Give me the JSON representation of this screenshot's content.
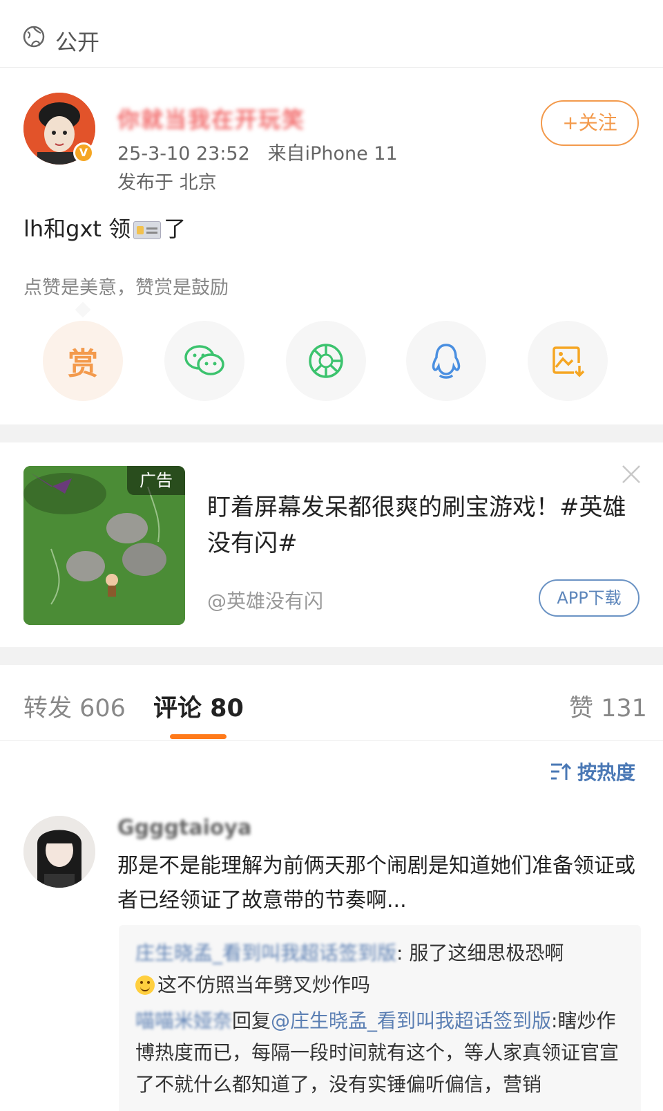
{
  "header": {
    "visibility_label": "公开"
  },
  "post": {
    "author_name": "你就当我在开玩笑",
    "timestamp": "25-3-10 23:52",
    "source": "来自iPhone 11",
    "location": "发布于 北京",
    "follow_label": "+关注",
    "text_before": "lh和gxt 领",
    "text_after": "了",
    "reward_hint": "点赞是美意，赞赏是鼓励",
    "reward_label": "赏"
  },
  "share_icons": [
    "reward-icon",
    "wechat-icon",
    "moments-icon",
    "qq-icon",
    "save-image-icon"
  ],
  "ad": {
    "tag": "广告",
    "title": "盯着屏幕发呆都很爽的刷宝游戏！#英雄没有闪#",
    "account": "@英雄没有闪",
    "download_label": "APP下载"
  },
  "tabs": {
    "repost": "转发 606",
    "comments": "评论 80",
    "likes": "赞 131"
  },
  "sort": {
    "label": "按热度"
  },
  "comment": {
    "author": "Ggggtaioya",
    "text": "那是不是能理解为前俩天那个闹剧是知道她们准备领证或者已经领证了故意带的节奏啊...",
    "replies": [
      {
        "author": "庄生晓孟_看到叫我超话签到版",
        "text_line1": ": 服了这细思极恐啊",
        "text_line2": "这不仿照当年劈叉炒作吗"
      },
      {
        "author": "喵喵米娅奈",
        "reply_word": "回复",
        "mention": "@庄生晓孟_看到叫我超话签到版",
        "text": ":瞎炒作博热度而已，每隔一段时间就有这个，等人家真领证官宣了不就什么都知道了，没有实锤偏听偏信，营销"
      }
    ]
  },
  "colors": {
    "accent": "#ff7a1a",
    "follow": "#f39a4c",
    "link": "#5b7fb3",
    "separator": "#f2f2f2"
  }
}
